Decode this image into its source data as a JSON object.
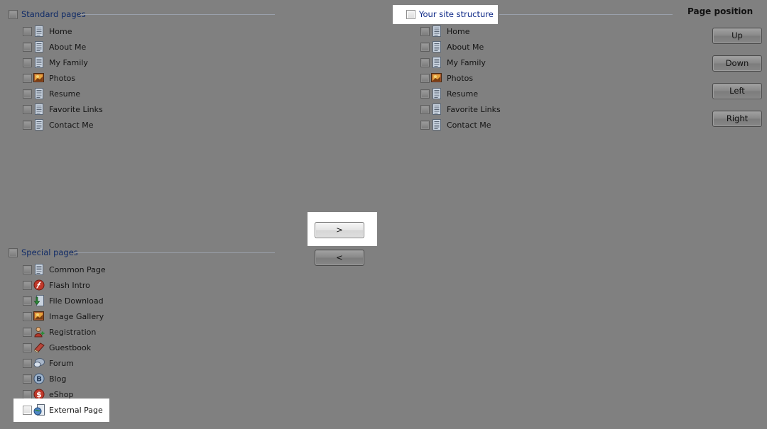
{
  "standard": {
    "title": "Standard pages",
    "items": [
      {
        "label": "Home",
        "icon": "page-icon"
      },
      {
        "label": "About Me",
        "icon": "page-icon"
      },
      {
        "label": "My Family",
        "icon": "page-icon"
      },
      {
        "label": "Photos",
        "icon": "photos-icon"
      },
      {
        "label": "Resume",
        "icon": "page-icon"
      },
      {
        "label": "Favorite Links",
        "icon": "page-icon"
      },
      {
        "label": "Contact Me",
        "icon": "page-icon"
      }
    ]
  },
  "structure": {
    "title": "Your site structure",
    "items": [
      {
        "label": "Home",
        "icon": "page-icon"
      },
      {
        "label": "About Me",
        "icon": "page-icon"
      },
      {
        "label": "My Family",
        "icon": "page-icon"
      },
      {
        "label": "Photos",
        "icon": "photos-icon"
      },
      {
        "label": "Resume",
        "icon": "page-icon"
      },
      {
        "label": "Favorite Links",
        "icon": "page-icon"
      },
      {
        "label": "Contact Me",
        "icon": "page-icon"
      }
    ]
  },
  "special": {
    "title": "Special pages",
    "items": [
      {
        "label": "Common Page",
        "icon": "page-icon"
      },
      {
        "label": "Flash Intro",
        "icon": "flash-icon"
      },
      {
        "label": "File Download",
        "icon": "download-icon"
      },
      {
        "label": "Image Gallery",
        "icon": "photos-icon"
      },
      {
        "label": "Registration",
        "icon": "registration-icon"
      },
      {
        "label": "Guestbook",
        "icon": "guestbook-icon"
      },
      {
        "label": "Forum",
        "icon": "forum-icon"
      },
      {
        "label": "Blog",
        "icon": "blog-icon"
      },
      {
        "label": "eShop",
        "icon": "eshop-icon"
      }
    ],
    "external": {
      "label": "External Page",
      "icon": "external-page-icon"
    }
  },
  "transfer": {
    "add_label": ">",
    "remove_label": "<"
  },
  "position": {
    "title": "Page position",
    "up": "Up",
    "down": "Down",
    "left": "Left",
    "right": "Right"
  },
  "colors": {
    "background": "#808080",
    "header_text": "#0f2a66",
    "highlight": "#ffffff"
  }
}
